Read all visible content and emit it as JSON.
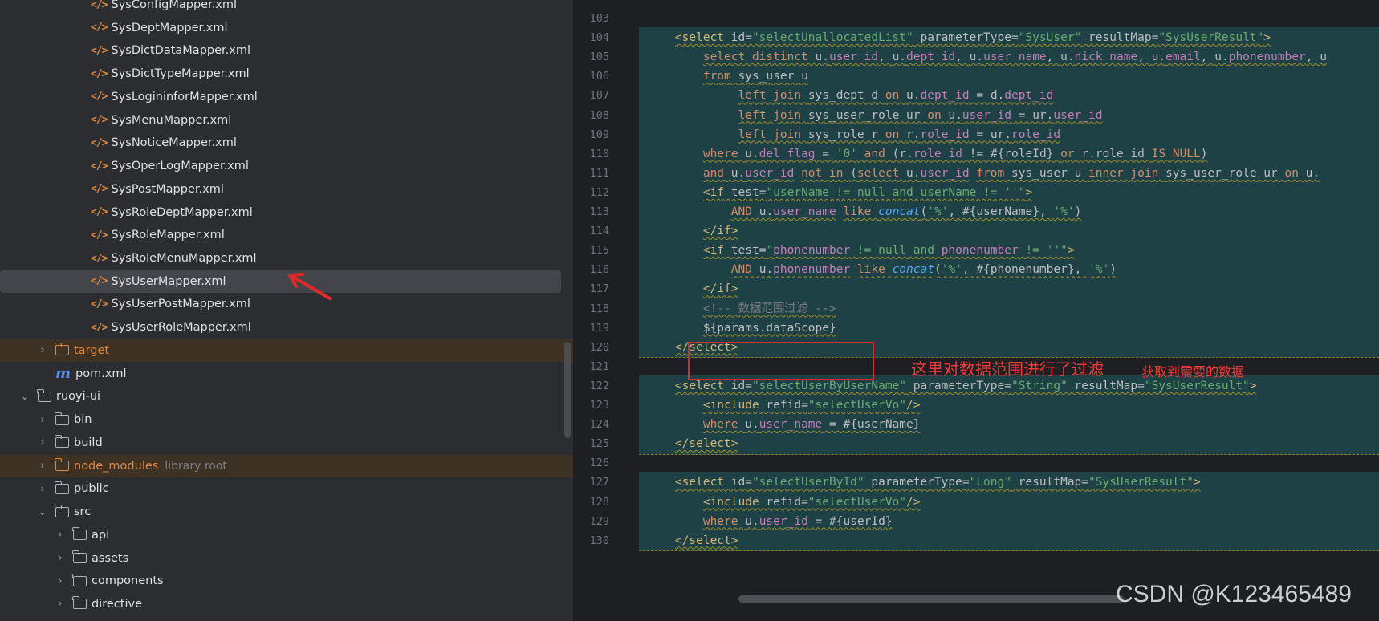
{
  "tree": {
    "items": [
      {
        "label": "SysConfigMapper.xml",
        "type": "xml",
        "indent": 3
      },
      {
        "label": "SysDeptMapper.xml",
        "type": "xml",
        "indent": 3
      },
      {
        "label": "SysDictDataMapper.xml",
        "type": "xml",
        "indent": 3
      },
      {
        "label": "SysDictTypeMapper.xml",
        "type": "xml",
        "indent": 3
      },
      {
        "label": "SysLogininforMapper.xml",
        "type": "xml",
        "indent": 3
      },
      {
        "label": "SysMenuMapper.xml",
        "type": "xml",
        "indent": 3
      },
      {
        "label": "SysNoticeMapper.xml",
        "type": "xml",
        "indent": 3
      },
      {
        "label": "SysOperLogMapper.xml",
        "type": "xml",
        "indent": 3
      },
      {
        "label": "SysPostMapper.xml",
        "type": "xml",
        "indent": 3
      },
      {
        "label": "SysRoleDeptMapper.xml",
        "type": "xml",
        "indent": 3
      },
      {
        "label": "SysRoleMapper.xml",
        "type": "xml",
        "indent": 3
      },
      {
        "label": "SysRoleMenuMapper.xml",
        "type": "xml",
        "indent": 3
      },
      {
        "label": "SysUserMapper.xml",
        "type": "xml",
        "indent": 3,
        "selected": true
      },
      {
        "label": "SysUserPostMapper.xml",
        "type": "xml",
        "indent": 3
      },
      {
        "label": "SysUserRoleMapper.xml",
        "type": "xml",
        "indent": 3
      },
      {
        "label": "target",
        "type": "folder",
        "indent": 1,
        "chevron": "›",
        "excluded": true
      },
      {
        "label": "pom.xml",
        "type": "maven",
        "indent": 1
      },
      {
        "label": "ruoyi-ui",
        "type": "folder",
        "indent": 0,
        "chevron": "⌄"
      },
      {
        "label": "bin",
        "type": "folder",
        "indent": 1,
        "chevron": "›"
      },
      {
        "label": "build",
        "type": "folder",
        "indent": 1,
        "chevron": "›"
      },
      {
        "label": "node_modules",
        "type": "folder",
        "indent": 1,
        "chevron": "›",
        "excluded": true,
        "note": "library root"
      },
      {
        "label": "public",
        "type": "folder",
        "indent": 1,
        "chevron": "›"
      },
      {
        "label": "src",
        "type": "folder",
        "indent": 1,
        "chevron": "⌄"
      },
      {
        "label": "api",
        "type": "folder",
        "indent": 2,
        "chevron": "›"
      },
      {
        "label": "assets",
        "type": "folder",
        "indent": 2,
        "chevron": "›"
      },
      {
        "label": "components",
        "type": "folder",
        "indent": 2,
        "chevron": "›"
      },
      {
        "label": "directive",
        "type": "folder",
        "indent": 2,
        "chevron": "›"
      }
    ]
  },
  "editor": {
    "lines": [
      {
        "n": "103",
        "hl": false,
        "tokens": []
      },
      {
        "n": "104",
        "hl": true,
        "hlFrom": 1,
        "tokens": [
          [
            "    ",
            "plain"
          ],
          [
            "<select",
            "tag"
          ],
          [
            " id=",
            "attr"
          ],
          [
            "\"selectUnallocatedList\"",
            "str"
          ],
          [
            " parameterType=",
            "attr"
          ],
          [
            "\"SysUser\"",
            "str"
          ],
          [
            " resultMap=",
            "attr"
          ],
          [
            "\"SysUserResult\"",
            "str"
          ],
          [
            ">",
            "tag"
          ]
        ]
      },
      {
        "n": "105",
        "hl": true,
        "hlFrom": 0,
        "tokens": [
          [
            "        ",
            "plain"
          ],
          [
            "select distinct ",
            "kw"
          ],
          [
            "u.",
            "plain"
          ],
          [
            "user_id",
            "fld"
          ],
          [
            ", ",
            "plain"
          ],
          [
            "u.",
            "plain"
          ],
          [
            "dept_id",
            "fld"
          ],
          [
            ", ",
            "plain"
          ],
          [
            "u.",
            "plain"
          ],
          [
            "user_name",
            "fld"
          ],
          [
            ", ",
            "plain"
          ],
          [
            "u.",
            "plain"
          ],
          [
            "nick_name",
            "fld"
          ],
          [
            ", ",
            "plain"
          ],
          [
            "u.",
            "plain"
          ],
          [
            "email",
            "fld"
          ],
          [
            ", ",
            "plain"
          ],
          [
            "u.",
            "plain"
          ],
          [
            "phonenumber",
            "fld"
          ],
          [
            ", u",
            "plain"
          ]
        ]
      },
      {
        "n": "106",
        "hl": true,
        "hlFrom": 0,
        "tokens": [
          [
            "        ",
            "plain"
          ],
          [
            "from ",
            "kw"
          ],
          [
            "sys_user u",
            "plain"
          ]
        ]
      },
      {
        "n": "107",
        "hl": true,
        "hlFrom": 0,
        "tokens": [
          [
            "             ",
            "plain"
          ],
          [
            "left join ",
            "kw"
          ],
          [
            "sys_dept d ",
            "plain"
          ],
          [
            "on ",
            "kw"
          ],
          [
            "u.",
            "plain"
          ],
          [
            "dept_id",
            "fld"
          ],
          [
            " = d.",
            "plain"
          ],
          [
            "dept_id",
            "fld"
          ]
        ]
      },
      {
        "n": "108",
        "hl": true,
        "hlFrom": 0,
        "tokens": [
          [
            "             ",
            "plain"
          ],
          [
            "left join ",
            "kw"
          ],
          [
            "sys_user_role ur ",
            "plain"
          ],
          [
            "on ",
            "kw"
          ],
          [
            "u.",
            "plain"
          ],
          [
            "user_id",
            "fld"
          ],
          [
            " = ur.",
            "plain"
          ],
          [
            "user_id",
            "fld"
          ]
        ]
      },
      {
        "n": "109",
        "hl": true,
        "hlFrom": 0,
        "tokens": [
          [
            "             ",
            "plain"
          ],
          [
            "left join ",
            "kw"
          ],
          [
            "sys_role r ",
            "plain"
          ],
          [
            "on ",
            "kw"
          ],
          [
            "r.",
            "plain"
          ],
          [
            "role_id",
            "fld"
          ],
          [
            " = ur.",
            "plain"
          ],
          [
            "role_id",
            "fld"
          ]
        ]
      },
      {
        "n": "110",
        "hl": true,
        "hlFrom": 0,
        "tokens": [
          [
            "        ",
            "plain"
          ],
          [
            "where ",
            "kw"
          ],
          [
            "u.",
            "plain"
          ],
          [
            "del_flag",
            "fld"
          ],
          [
            " = ",
            "plain"
          ],
          [
            "'0'",
            "str"
          ],
          [
            " and ",
            "kw"
          ],
          [
            "(r.",
            "plain"
          ],
          [
            "role_id",
            "fld"
          ],
          [
            " != #{roleId} ",
            "plain"
          ],
          [
            "or ",
            "kw"
          ],
          [
            "r.role_id ",
            "plain"
          ],
          [
            "IS NULL",
            "kw"
          ],
          [
            ")",
            "plain"
          ]
        ]
      },
      {
        "n": "111",
        "hl": true,
        "hlFrom": 0,
        "tokens": [
          [
            "        ",
            "plain"
          ],
          [
            "and ",
            "kw"
          ],
          [
            "u.",
            "plain"
          ],
          [
            "user_id",
            "fld"
          ],
          [
            " ",
            "plain"
          ],
          [
            "not in ",
            "kw"
          ],
          [
            "(",
            "plain"
          ],
          [
            "select ",
            "kw"
          ],
          [
            "u.",
            "plain"
          ],
          [
            "user_id",
            "fld"
          ],
          [
            " ",
            "plain"
          ],
          [
            "from ",
            "kw"
          ],
          [
            "sys_user u ",
            "plain"
          ],
          [
            "inner join ",
            "kw"
          ],
          [
            "sys_user_role ur ",
            "plain"
          ],
          [
            "on ",
            "kw"
          ],
          [
            "u.",
            "plain"
          ]
        ]
      },
      {
        "n": "112",
        "hl": true,
        "hlFrom": 0,
        "tokens": [
          [
            "        ",
            "plain"
          ],
          [
            "<if",
            "tag"
          ],
          [
            " test=",
            "attr"
          ],
          [
            "\"userName != null and userName != ''\"",
            "str"
          ],
          [
            ">",
            "tag"
          ]
        ]
      },
      {
        "n": "113",
        "hl": true,
        "hlFrom": 0,
        "tokens": [
          [
            "            ",
            "plain"
          ],
          [
            "AND ",
            "kw"
          ],
          [
            "u.",
            "plain"
          ],
          [
            "user_name",
            "fld"
          ],
          [
            " ",
            "plain"
          ],
          [
            "like ",
            "kw"
          ],
          [
            "concat",
            "fn"
          ],
          [
            "(",
            "plain"
          ],
          [
            "'%'",
            "str"
          ],
          [
            ", #{userName}, ",
            "plain"
          ],
          [
            "'%'",
            "str"
          ],
          [
            ")",
            "plain"
          ]
        ]
      },
      {
        "n": "114",
        "hl": true,
        "hlFrom": 0,
        "tokens": [
          [
            "        ",
            "plain"
          ],
          [
            "</if>",
            "tag"
          ]
        ]
      },
      {
        "n": "115",
        "hl": true,
        "hlFrom": 0,
        "tokens": [
          [
            "        ",
            "plain"
          ],
          [
            "<if",
            "tag"
          ],
          [
            " test=",
            "attr"
          ],
          [
            "\"",
            "str"
          ],
          [
            "phonenumber",
            "fld"
          ],
          [
            " != null and ",
            "str"
          ],
          [
            "phonenumber",
            "fld"
          ],
          [
            " != ''\"",
            "str"
          ],
          [
            ">",
            "tag"
          ]
        ]
      },
      {
        "n": "116",
        "hl": true,
        "hlFrom": 0,
        "tokens": [
          [
            "            ",
            "plain"
          ],
          [
            "AND ",
            "kw"
          ],
          [
            "u.",
            "plain"
          ],
          [
            "phonenumber",
            "fld"
          ],
          [
            " ",
            "plain"
          ],
          [
            "like ",
            "kw"
          ],
          [
            "concat",
            "fn"
          ],
          [
            "(",
            "plain"
          ],
          [
            "'%'",
            "str"
          ],
          [
            ", #{phonenumber}, ",
            "plain"
          ],
          [
            "'%'",
            "str"
          ],
          [
            ")",
            "plain"
          ]
        ]
      },
      {
        "n": "117",
        "hl": true,
        "hlFrom": 0,
        "tokens": [
          [
            "        ",
            "plain"
          ],
          [
            "</if>",
            "tag"
          ]
        ]
      },
      {
        "n": "118",
        "hl": true,
        "hlFrom": 0,
        "tokens": [
          [
            "        ",
            "plain"
          ],
          [
            "<!-- 数据范围过滤 -->",
            "cmt"
          ]
        ]
      },
      {
        "n": "119",
        "hl": true,
        "hlFrom": 0,
        "tokens": [
          [
            "        ",
            "plain"
          ],
          [
            "${params.dataScope}",
            "plain"
          ]
        ]
      },
      {
        "n": "120",
        "hl": true,
        "hlFrom": 0,
        "tokens": [
          [
            "    ",
            "plain"
          ],
          [
            "</select>",
            "tag"
          ]
        ]
      },
      {
        "n": "121",
        "hl": false,
        "tokens": []
      },
      {
        "n": "122",
        "hl": true,
        "hlFrom": 1,
        "tokens": [
          [
            "    ",
            "plain"
          ],
          [
            "<select",
            "tag"
          ],
          [
            " id=",
            "attr"
          ],
          [
            "\"selectUserByUserName\"",
            "str"
          ],
          [
            " parameterType=",
            "attr"
          ],
          [
            "\"String\"",
            "str"
          ],
          [
            " resultMap=",
            "attr"
          ],
          [
            "\"SysUserResult\"",
            "str"
          ],
          [
            ">",
            "tag"
          ]
        ]
      },
      {
        "n": "123",
        "hl": true,
        "hlFrom": 0,
        "tokens": [
          [
            "        ",
            "plain"
          ],
          [
            "<include",
            "tag"
          ],
          [
            " refid=",
            "attr"
          ],
          [
            "\"selectUserVo\"",
            "str"
          ],
          [
            "/>",
            "tag"
          ]
        ]
      },
      {
        "n": "124",
        "hl": true,
        "hlFrom": 0,
        "tokens": [
          [
            "        ",
            "plain"
          ],
          [
            "where ",
            "kw"
          ],
          [
            "u.",
            "plain"
          ],
          [
            "user_name",
            "fld"
          ],
          [
            " = #{userName}",
            "plain"
          ]
        ]
      },
      {
        "n": "125",
        "hl": true,
        "hlFrom": 0,
        "tokens": [
          [
            "    ",
            "plain"
          ],
          [
            "</select>",
            "tag"
          ]
        ]
      },
      {
        "n": "126",
        "hl": false,
        "tokens": []
      },
      {
        "n": "127",
        "hl": true,
        "hlFrom": 1,
        "tokens": [
          [
            "    ",
            "plain"
          ],
          [
            "<select",
            "tag"
          ],
          [
            " id=",
            "attr"
          ],
          [
            "\"selectUserById\"",
            "str"
          ],
          [
            " parameterType=",
            "attr"
          ],
          [
            "\"Long\"",
            "str"
          ],
          [
            " resultMap=",
            "attr"
          ],
          [
            "\"SysUserResult\"",
            "str"
          ],
          [
            ">",
            "tag"
          ]
        ]
      },
      {
        "n": "128",
        "hl": true,
        "hlFrom": 0,
        "tokens": [
          [
            "        ",
            "plain"
          ],
          [
            "<include",
            "tag"
          ],
          [
            " refid=",
            "attr"
          ],
          [
            "\"selectUserVo\"",
            "str"
          ],
          [
            "/>",
            "tag"
          ]
        ]
      },
      {
        "n": "129",
        "hl": true,
        "hlFrom": 0,
        "tokens": [
          [
            "        ",
            "plain"
          ],
          [
            "where ",
            "kw"
          ],
          [
            "u.",
            "plain"
          ],
          [
            "user_id",
            "fld"
          ],
          [
            " = #{userId}",
            "plain"
          ]
        ]
      },
      {
        "n": "130",
        "hl": true,
        "hlFrom": 0,
        "tokens": [
          [
            "    ",
            "plain"
          ],
          [
            "</select>",
            "tag"
          ]
        ]
      }
    ]
  },
  "annotation": {
    "primary": "这里对数据范围进行了过滤",
    "secondary": "获取到需要的数据"
  },
  "watermark": "CSDN @K123465489",
  "colors": {
    "accent_red": "#e22929",
    "highlight": "#1e4145",
    "excluded_folder": "#e0883e"
  }
}
